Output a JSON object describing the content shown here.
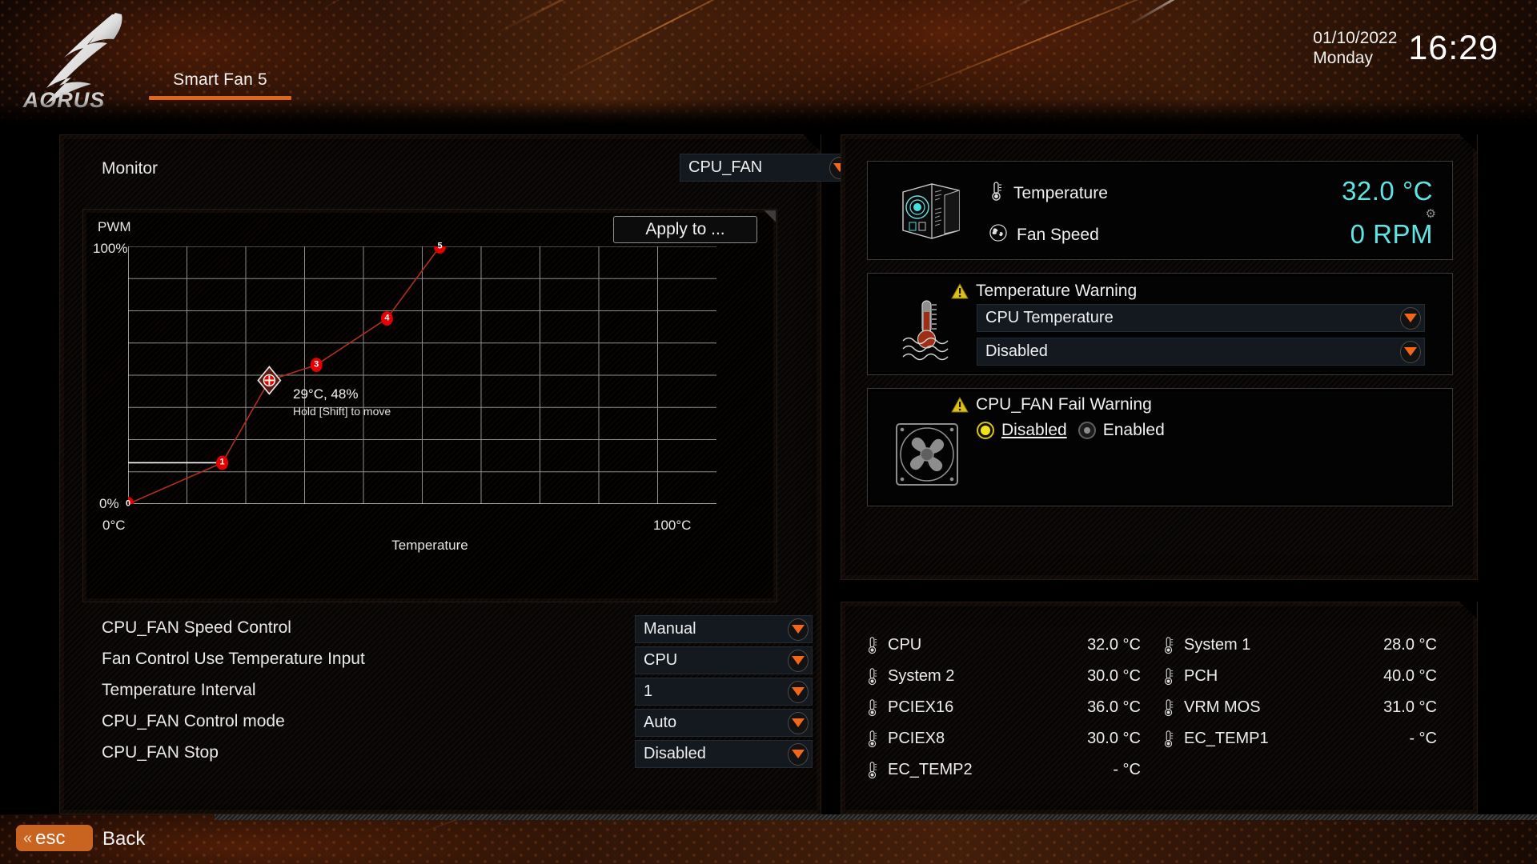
{
  "header": {
    "brand": "AORUS",
    "page_title": "Smart Fan 5",
    "date": "01/10/2022",
    "day": "Monday",
    "time": "16:29"
  },
  "monitor": {
    "label": "Monitor",
    "fan_selected": "CPU_FAN"
  },
  "chart_controls": {
    "apply_to": "Apply to ..."
  },
  "chart_data": {
    "type": "line",
    "title": "",
    "xlabel": "Temperature",
    "ylabel": "PWM",
    "xlim": [
      0,
      100
    ],
    "ylim": [
      0,
      100
    ],
    "x_tick_labels": [
      "0°C",
      "100°C"
    ],
    "y_tick_labels": [
      "0%",
      "100%"
    ],
    "grid": true,
    "grid_cols": 10,
    "grid_rows": 8,
    "points": [
      {
        "id": "0",
        "x": 0,
        "y": 0,
        "selected": false
      },
      {
        "id": "1",
        "x": 16,
        "y": 16,
        "selected": false
      },
      {
        "id": "2",
        "x": 24,
        "y": 48,
        "selected": true
      },
      {
        "id": "3",
        "x": 32,
        "y": 54,
        "selected": false
      },
      {
        "id": "4",
        "x": 44,
        "y": 72,
        "selected": false
      },
      {
        "id": "5",
        "x": 53,
        "y": 100,
        "selected": false
      }
    ],
    "stop_line": {
      "from_x": 0,
      "to_x": 16,
      "y": 16
    },
    "selected_point_tooltip": {
      "value": "29°C, 48%",
      "hint": "Hold [Shift] to move"
    },
    "series_color": "#b0301a",
    "point_color": "#e60000"
  },
  "settings": {
    "rows": [
      {
        "label": "CPU_FAN Speed Control",
        "value": "Manual"
      },
      {
        "label": "Fan Control Use Temperature Input",
        "value": "CPU"
      },
      {
        "label": "Temperature Interval",
        "value": "1"
      },
      {
        "label": "CPU_FAN Control mode",
        "value": "Auto"
      },
      {
        "label": "CPU_FAN Stop",
        "value": "Disabled"
      }
    ]
  },
  "readout": {
    "temperature_label": "Temperature",
    "temperature_value": "32.0 °C",
    "fanspeed_label": "Fan Speed",
    "fanspeed_value": "0 RPM"
  },
  "temp_warning": {
    "title": "Temperature Warning",
    "source": "CPU Temperature",
    "state": "Disabled"
  },
  "fan_fail_warning": {
    "title": "CPU_FAN Fail Warning",
    "options": [
      {
        "label": "Disabled",
        "selected": true
      },
      {
        "label": "Enabled",
        "selected": false
      }
    ]
  },
  "sensors": {
    "rows": [
      [
        {
          "name": "CPU",
          "value": "32.0 °C"
        },
        {
          "name": "System 1",
          "value": "28.0 °C"
        }
      ],
      [
        {
          "name": "System 2",
          "value": "30.0 °C"
        },
        {
          "name": "PCH",
          "value": "40.0 °C"
        }
      ],
      [
        {
          "name": "PCIEX16",
          "value": "36.0 °C"
        },
        {
          "name": "VRM MOS",
          "value": "31.0 °C"
        }
      ],
      [
        {
          "name": "PCIEX8",
          "value": "30.0 °C"
        },
        {
          "name": "EC_TEMP1",
          "value": "- °C"
        }
      ],
      [
        {
          "name": "EC_TEMP2",
          "value": "- °C"
        },
        {
          "name": "",
          "value": ""
        }
      ]
    ]
  },
  "footer": {
    "esc_key": "esc",
    "esc_chevron": "«",
    "back_label": "Back"
  },
  "colors": {
    "accent_orange": "#e0661c",
    "cyan_value": "#5fe3e3",
    "warn_yellow": "#e6c21a",
    "point_red": "#e60000"
  }
}
